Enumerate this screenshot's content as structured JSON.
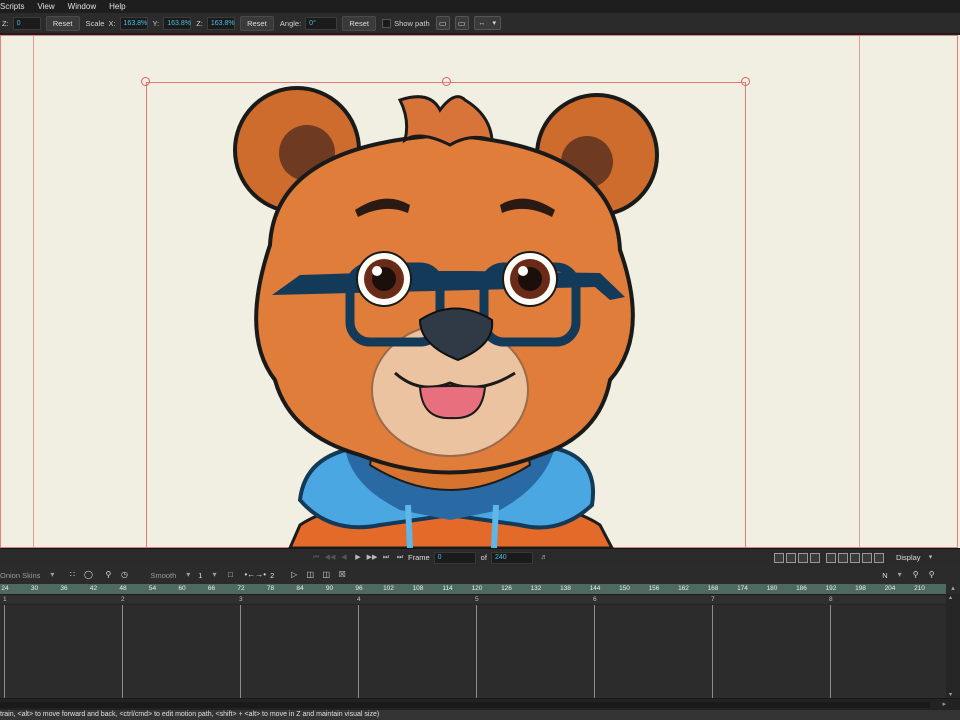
{
  "menu": [
    "Scripts",
    "View",
    "Window",
    "Help"
  ],
  "toolbar": {
    "z_label": "Z:",
    "z_value": "0",
    "reset1": "Reset",
    "scale_label": "Scale",
    "sx_label": "X:",
    "sx_value": "163.8%",
    "sy_label": "Y:",
    "sy_value": "163.8%",
    "sz_label": "Z:",
    "sz_value": "163.8%",
    "reset2": "Reset",
    "angle_label": "Angle:",
    "angle_value": "0°",
    "reset3": "Reset",
    "show_path_label": "Show path"
  },
  "playback": {
    "frame_label": "Frame",
    "frame_value": "0",
    "of_label": "of",
    "of_value": "240",
    "display_label": "Display"
  },
  "timeline": {
    "onion_skins": "Onion Skins",
    "interp": "Smooth",
    "interp_num": "1",
    "key_count": "2",
    "n_label": "N",
    "ruler_ticks": [
      "24",
      "30",
      "36",
      "42",
      "48",
      "54",
      "60",
      "66",
      "72",
      "78",
      "84",
      "90",
      "96",
      "102",
      "108",
      "114",
      "120",
      "126",
      "132",
      "138",
      "144",
      "150",
      "156",
      "162",
      "168",
      "174",
      "180",
      "186",
      "192",
      "198",
      "204",
      "210"
    ],
    "track_markers": [
      "1",
      "2",
      "3",
      "4",
      "5",
      "6",
      "7",
      "8"
    ]
  },
  "status_text": "train, <alt> to move forward and back, <ctrl/cmd> to edit motion path, <shift> + <alt> to move in Z and maintain visual size)",
  "colors": {
    "canvas_bg": "#f0efe2",
    "ruler_bg": "#4e6a60",
    "field_value": "#47c1e6",
    "selection": "#e07b7b"
  },
  "icons": {
    "play": "play-icon",
    "display": "display-dropdown-icon",
    "zoom": "zoom-icon"
  }
}
